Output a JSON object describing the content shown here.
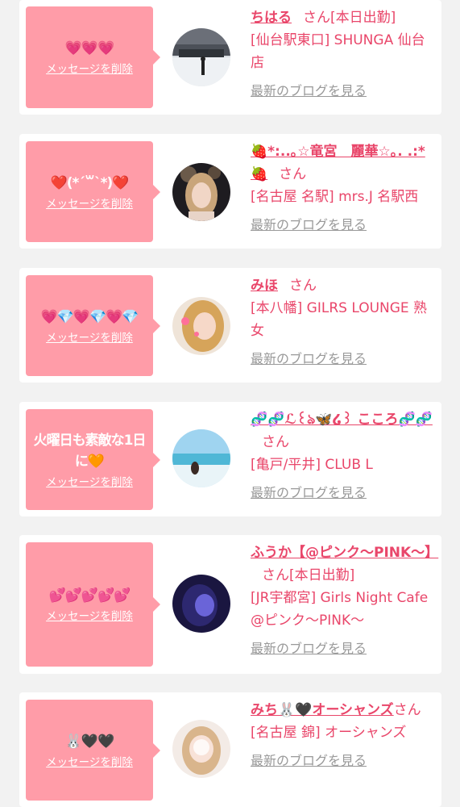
{
  "common": {
    "delete_label": "メッセージを削除",
    "san_label": "さん",
    "blog_label": "最新のブログを見る"
  },
  "cards": [
    {
      "message": "💗💗💗",
      "name": "ちはる",
      "tag": "[本日出勤]",
      "shop": "[仙台駅東口] SHUNGA 仙台店"
    },
    {
      "message": "❤️(*´꒳`*)❤️",
      "name": "🍓*:..｡☆竜宮　麗華☆｡. .:*🍓",
      "tag": "",
      "shop": "[名古屋 名駅] mrs.J 名駅西"
    },
    {
      "message": "💗💎💗💎💗💎",
      "name": "みほ",
      "tag": "",
      "shop": "[本八幡] GILRS LOUNGE 熟女"
    },
    {
      "message": "火曜日も素敵な1日に🧡",
      "name": "🧬🧬ℒ꒰ঌ🦋໒꒱ こころ🧬🧬",
      "tag": "",
      "shop": "[亀戸/平井] CLUB L"
    },
    {
      "message": "💕💕💕💕💕",
      "name": "ふうか【@ピンク〜PINK〜】",
      "tag": "[本日出勤]",
      "shop": "[JR宇都宮] Girls Night Cafe @ピンク〜PINK〜"
    },
    {
      "message": "🐰🖤🖤",
      "name": "みち🐰🖤オーシャンズ",
      "tag": "",
      "shop": "[名古屋 錦] オーシャンズ"
    }
  ],
  "colors": {
    "accent": "#e9466a",
    "bubble": "#ff9ca8",
    "background": "#f2f2f2",
    "muted_link": "#999999"
  }
}
